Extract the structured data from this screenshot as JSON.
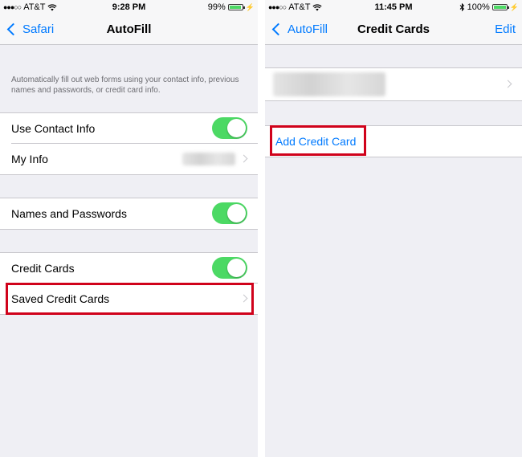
{
  "left": {
    "status": {
      "carrier": "AT&T",
      "time": "9:28 PM",
      "battery": "99%",
      "battery_level": 0.99
    },
    "nav": {
      "back": "Safari",
      "title": "AutoFill"
    },
    "description": "Automatically fill out web forms using your contact info, previous names and passwords, or credit card info.",
    "rows": {
      "use_contact_info": "Use Contact Info",
      "my_info": "My Info",
      "names_passwords": "Names and Passwords",
      "credit_cards": "Credit Cards",
      "saved_credit_cards": "Saved Credit Cards"
    },
    "toggles": {
      "use_contact_info": true,
      "names_passwords": true,
      "credit_cards": true
    }
  },
  "right": {
    "status": {
      "carrier": "AT&T",
      "time": "11:45 PM",
      "battery": "100%",
      "battery_level": 1.0
    },
    "nav": {
      "back": "AutoFill",
      "title": "Credit Cards",
      "edit": "Edit"
    },
    "add_card": "Add Credit Card"
  },
  "colors": {
    "accent": "#007aff",
    "toggle_on": "#4cd964",
    "highlight": "#d0021b"
  }
}
